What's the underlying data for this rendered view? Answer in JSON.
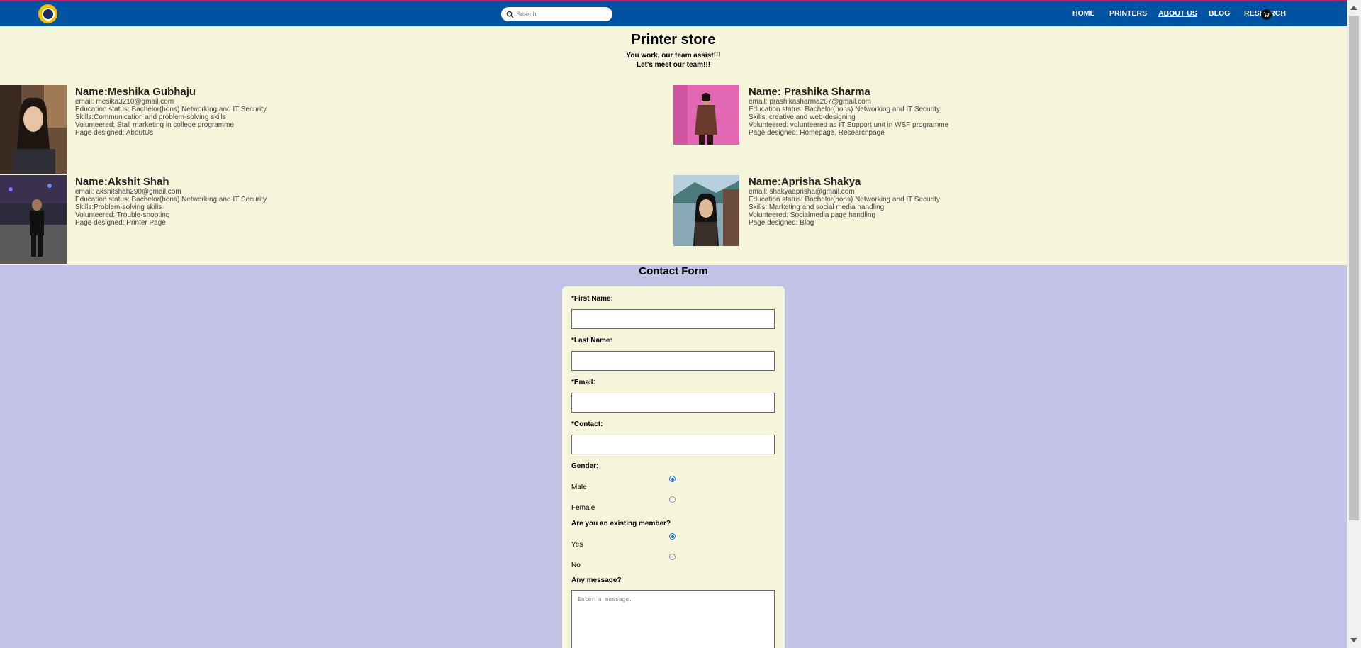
{
  "nav": {
    "search_placeholder": "Search",
    "links": [
      "HOME",
      "PRINTERS",
      "ABOUT US",
      "BLOG",
      "RESEARCH"
    ],
    "active": "ABOUT US"
  },
  "team": {
    "title": "Printer store",
    "tagline1": "You work, our team assist!!!",
    "tagline2": "Let's meet our team!!!",
    "members": [
      {
        "name": "Name:Meshika Gubhaju",
        "lines": [
          "email: mesika3210@gmail.com",
          "Education status: Bachelor(hons) Networking and IT Security",
          "Skills:Communication and problem-solving skills",
          "Volunteered: Stall marketing in college programme",
          "Page designed: AboutUs"
        ]
      },
      {
        "name": "Name: Prashika Sharma",
        "lines": [
          "email: prashikasharma287@gmail.com",
          "Education status: Bachelor(hons) Networking and IT Security",
          "Skills: creative and web-designing",
          "Volunteered: volunteered as IT Support unit in WSF programme",
          "Page designed: Homepage, Researchpage"
        ]
      },
      {
        "name": "Name:Akshit Shah",
        "lines": [
          "email: akshitshah290@gmail.com",
          "Education status: Bachelor(hons) Networking and IT Security",
          "Skills:Problem-solving skills",
          "Volunteered: Trouble-shooting",
          "Page designed: Printer Page"
        ]
      },
      {
        "name": "Name:Aprisha Shakya",
        "lines": [
          "email: shakyaaprisha@gmail.com",
          "Education status: Bachelor(hons) Networking and IT Security",
          "Skills: Marketing and social media handling",
          "Volunteered: Socialmedia page handling",
          "Page designed: Blog"
        ]
      }
    ]
  },
  "contact": {
    "title": "Contact Form",
    "first_name_label": "*First Name:",
    "last_name_label": "*Last Name:",
    "email_label": "*Email:",
    "contact_label": "*Contact:",
    "gender_label": "Gender:",
    "gender_options": [
      "Male",
      "Female"
    ],
    "gender_selected": "Male",
    "member_label": "Are you an existing member?",
    "member_options": [
      "Yes",
      "No"
    ],
    "member_selected": "Yes",
    "message_label": "Any message?",
    "message_placeholder": "Enter a message.."
  },
  "icons": {
    "logo": "logo-badge",
    "search": "search-icon",
    "cart": "cart-icon"
  },
  "colors": {
    "navbar": "#0052a3",
    "team_bg": "#f5f5dc",
    "contact_bg": "#c2c2e6"
  }
}
